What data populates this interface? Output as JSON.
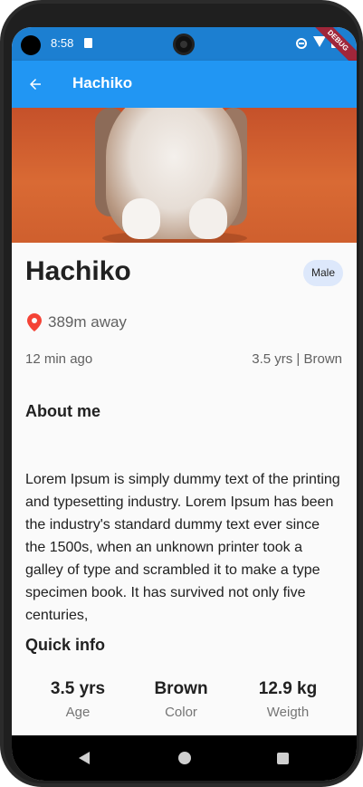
{
  "status_bar": {
    "time": "8:58",
    "debug_label": "DEBUG"
  },
  "app_bar": {
    "title": "Hachiko",
    "back_icon": "arrow-back-icon",
    "color": "#2196f3"
  },
  "pet": {
    "name": "Hachiko",
    "gender": "Male",
    "distance": "389m away",
    "location_icon": "location-pin-icon",
    "posted": "12 min ago",
    "age_color": "3.5 yrs | Brown"
  },
  "about": {
    "heading": "About me",
    "text": "Lorem Ipsum is simply dummy text of the printing and typesetting industry. Lorem Ipsum has been the industry's standard dummy text ever since the 1500s, when an unknown printer took a galley of type and scrambled it to make a type specimen book. It has survived not only five centuries,"
  },
  "quick_info": {
    "heading": "Quick info",
    "stats": [
      {
        "value": "3.5 yrs",
        "label": "Age"
      },
      {
        "value": "Brown",
        "label": "Color"
      },
      {
        "value": "12.9 kg",
        "label": "Weigth"
      }
    ]
  },
  "colors": {
    "accent": "#2196f3",
    "pin": "#f44336",
    "chip": "#dde8fb"
  }
}
